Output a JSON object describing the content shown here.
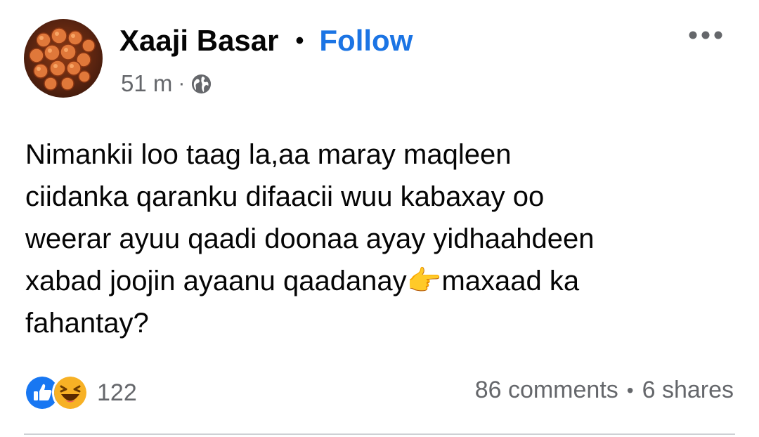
{
  "post": {
    "author": "Xaaji Basar",
    "separator": "•",
    "follow_label": "Follow",
    "timestamp": "51 m",
    "meta_separator": "·",
    "privacy_icon": "globe-icon",
    "more_icon": "more-horizontal-icon",
    "text": "Nimankii loo taag la,aa maray maqleen\nciidanka qaranku difaacii wuu kabaxay oo\nweerar ayuu qaadi doonaa ayay yidhaahdeen\nxabad joojin ayaanu qaadanay👉maxaad ka\nfahantay?"
  },
  "reactions": {
    "icons": [
      "like-icon",
      "haha-icon"
    ],
    "count": "122"
  },
  "engagement": {
    "comments": "86 comments",
    "separator": "•",
    "shares": "6 shares"
  },
  "colors": {
    "accent": "#1b74e4",
    "secondary_text": "#65676b",
    "like_blue": "#1877f2",
    "haha_yellow": "#f7b125"
  }
}
